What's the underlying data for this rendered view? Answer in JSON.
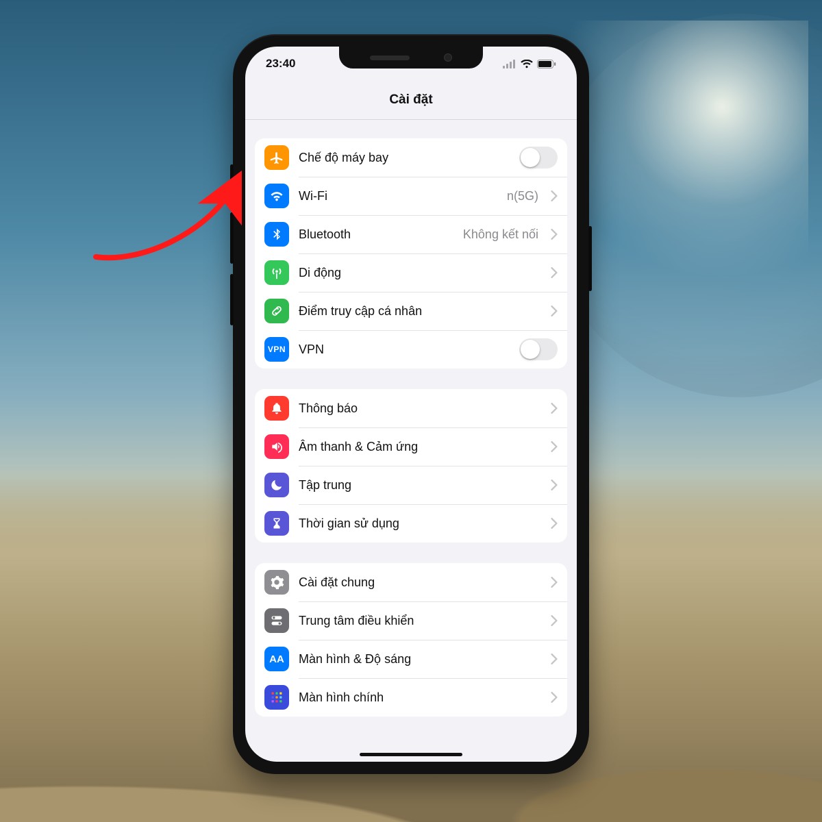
{
  "statusbar": {
    "time": "23:40"
  },
  "header": {
    "title": "Cài đặt"
  },
  "groups": [
    {
      "rows": [
        {
          "key": "airplane",
          "label": "Chế độ máy bay",
          "icon": "airplane-icon",
          "color": "c-orange",
          "control": "toggle",
          "toggled": false
        },
        {
          "key": "wifi",
          "label": "Wi-Fi",
          "icon": "wifi-icon",
          "color": "c-blue",
          "control": "nav",
          "detail": "n(5G)"
        },
        {
          "key": "bluetooth",
          "label": "Bluetooth",
          "icon": "bluetooth-icon",
          "color": "c-blue",
          "control": "nav",
          "detail": "Không kết nối"
        },
        {
          "key": "cellular",
          "label": "Di động",
          "icon": "antenna-icon",
          "color": "c-green",
          "control": "nav"
        },
        {
          "key": "hotspot",
          "label": "Điểm truy cập cá nhân",
          "icon": "link-icon",
          "color": "c-green2",
          "control": "nav"
        },
        {
          "key": "vpn",
          "label": "VPN",
          "icon": "vpn-icon",
          "color": "c-vpn",
          "control": "toggle",
          "toggled": false,
          "iconText": "VPN"
        }
      ]
    },
    {
      "rows": [
        {
          "key": "notifications",
          "label": "Thông báo",
          "icon": "bell-icon",
          "color": "c-red",
          "control": "nav"
        },
        {
          "key": "sounds",
          "label": "Âm thanh & Cảm ứng",
          "icon": "speaker-icon",
          "color": "c-pink",
          "control": "nav"
        },
        {
          "key": "focus",
          "label": "Tập trung",
          "icon": "moon-icon",
          "color": "c-indigo",
          "control": "nav"
        },
        {
          "key": "screentime",
          "label": "Thời gian sử dụng",
          "icon": "hourglass-icon",
          "color": "c-indigo",
          "control": "nav"
        }
      ]
    },
    {
      "rows": [
        {
          "key": "general",
          "label": "Cài đặt chung",
          "icon": "gear-icon",
          "color": "c-gray",
          "control": "nav"
        },
        {
          "key": "control",
          "label": "Trung tâm điều khiển",
          "icon": "switches-icon",
          "color": "c-darkgray",
          "control": "nav"
        },
        {
          "key": "display",
          "label": "Màn hình & Độ sáng",
          "icon": "aa-icon",
          "color": "c-aa",
          "control": "nav",
          "iconText": "AA"
        },
        {
          "key": "home",
          "label": "Màn hình chính",
          "icon": "grid-icon",
          "color": "c-tile",
          "control": "nav"
        }
      ]
    }
  ]
}
